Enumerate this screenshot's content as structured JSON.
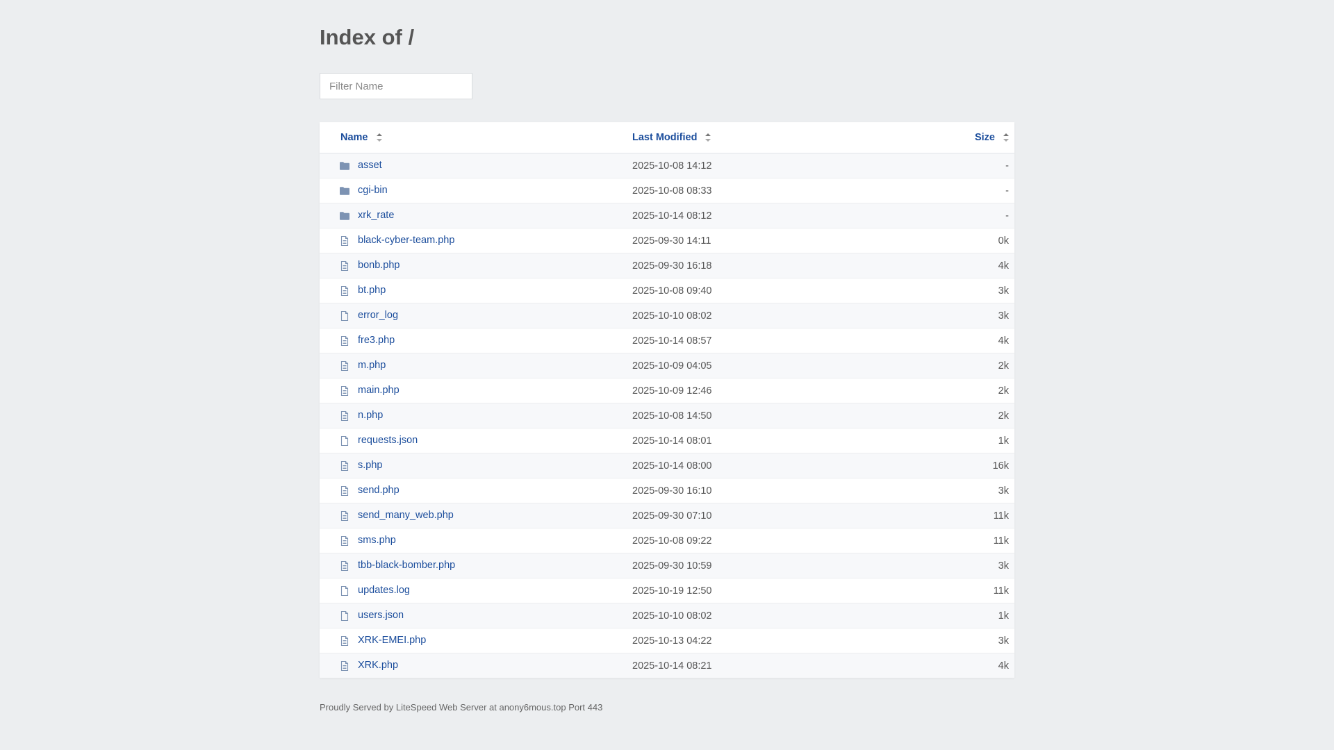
{
  "page": {
    "title": "Index of /",
    "filter_placeholder": "Filter Name",
    "footer": "Proudly Served by LiteSpeed Web Server at anony6mous.top Port 443"
  },
  "table": {
    "headers": {
      "name": "Name",
      "modified": "Last Modified",
      "size": "Size"
    },
    "rows": [
      {
        "name": "asset",
        "modified": "2025-10-08 14:12",
        "size": "-",
        "icon": "folder-icon"
      },
      {
        "name": "cgi-bin",
        "modified": "2025-10-08 08:33",
        "size": "-",
        "icon": "folder-icon"
      },
      {
        "name": "xrk_rate",
        "modified": "2025-10-14 08:12",
        "size": "-",
        "icon": "folder-icon"
      },
      {
        "name": "black-cyber-team.php",
        "modified": "2025-09-30 14:11",
        "size": "0k",
        "icon": "file-text-icon"
      },
      {
        "name": "bonb.php",
        "modified": "2025-09-30 16:18",
        "size": "4k",
        "icon": "file-text-icon"
      },
      {
        "name": "bt.php",
        "modified": "2025-10-08 09:40",
        "size": "3k",
        "icon": "file-text-icon"
      },
      {
        "name": "error_log",
        "modified": "2025-10-10 08:02",
        "size": "3k",
        "icon": "file-icon"
      },
      {
        "name": "fre3.php",
        "modified": "2025-10-14 08:57",
        "size": "4k",
        "icon": "file-text-icon"
      },
      {
        "name": "m.php",
        "modified": "2025-10-09 04:05",
        "size": "2k",
        "icon": "file-text-icon"
      },
      {
        "name": "main.php",
        "modified": "2025-10-09 12:46",
        "size": "2k",
        "icon": "file-text-icon"
      },
      {
        "name": "n.php",
        "modified": "2025-10-08 14:50",
        "size": "2k",
        "icon": "file-text-icon"
      },
      {
        "name": "requests.json",
        "modified": "2025-10-14 08:01",
        "size": "1k",
        "icon": "file-icon"
      },
      {
        "name": "s.php",
        "modified": "2025-10-14 08:00",
        "size": "16k",
        "icon": "file-text-icon"
      },
      {
        "name": "send.php",
        "modified": "2025-09-30 16:10",
        "size": "3k",
        "icon": "file-text-icon"
      },
      {
        "name": "send_many_web.php",
        "modified": "2025-09-30 07:10",
        "size": "11k",
        "icon": "file-text-icon"
      },
      {
        "name": "sms.php",
        "modified": "2025-10-08 09:22",
        "size": "11k",
        "icon": "file-text-icon"
      },
      {
        "name": "tbb-black-bomber.php",
        "modified": "2025-09-30 10:59",
        "size": "3k",
        "icon": "file-text-icon"
      },
      {
        "name": "updates.log",
        "modified": "2025-10-19 12:50",
        "size": "11k",
        "icon": "file-icon"
      },
      {
        "name": "users.json",
        "modified": "2025-10-10 08:02",
        "size": "1k",
        "icon": "file-icon"
      },
      {
        "name": "XRK-EMEI.php",
        "modified": "2025-10-13 04:22",
        "size": "3k",
        "icon": "file-text-icon"
      },
      {
        "name": "XRK.php",
        "modified": "2025-10-14 08:21",
        "size": "4k",
        "icon": "file-text-icon"
      }
    ]
  },
  "colors": {
    "background": "#eceef0",
    "link": "#1b4d9c",
    "folder": "#7d93b3",
    "file": "#7d93b3"
  }
}
